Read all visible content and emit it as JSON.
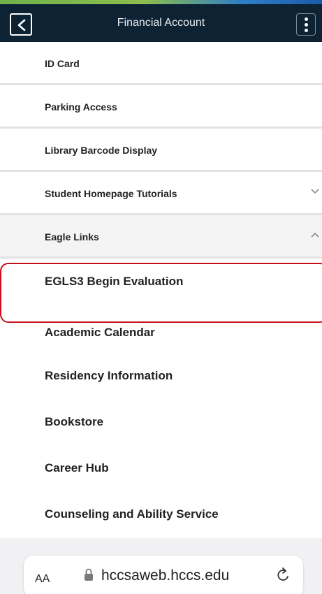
{
  "header": {
    "title": "Financial Account"
  },
  "menu": {
    "items": [
      {
        "label": "ID Card"
      },
      {
        "label": "Parking Access"
      },
      {
        "label": "Library Barcode Display"
      },
      {
        "label": "Student Homepage Tutorials"
      },
      {
        "label": "Eagle Links"
      }
    ]
  },
  "eagle_links": {
    "items": [
      {
        "label": "EGLS3 Begin Evaluation"
      },
      {
        "label": "Academic Calendar"
      },
      {
        "label": "Residency Information"
      },
      {
        "label": "Bookstore"
      },
      {
        "label": "Career Hub"
      },
      {
        "label": "Counseling and Ability Service"
      }
    ]
  },
  "browser": {
    "text_size_label": "AA",
    "url": "hccsaweb.hccs.edu"
  },
  "colors": {
    "header_bg": "#0d2233",
    "highlight": "#c8101e",
    "divider": "#e3e3e3"
  },
  "icons": [
    "chevron-left-icon",
    "more-vertical-icon",
    "chevron-down-icon",
    "chevron-up-icon",
    "lock-icon",
    "reload-icon"
  ]
}
